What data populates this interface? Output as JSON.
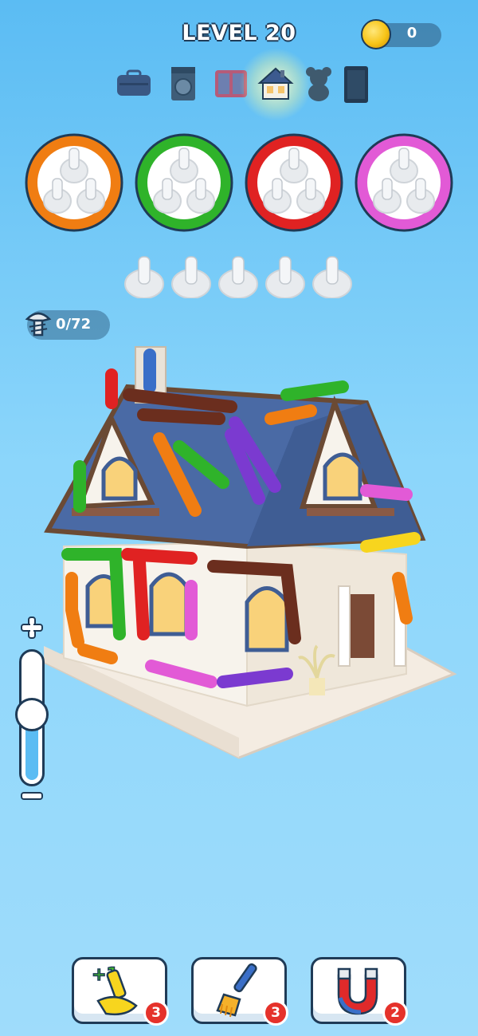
{
  "header": {
    "level_label": "LEVEL 20",
    "coins": "0"
  },
  "categories": [
    {
      "icon": "suitcase-icon",
      "selected": false
    },
    {
      "icon": "washing-machine-icon",
      "selected": false
    },
    {
      "icon": "wardrobe-icon",
      "selected": false
    },
    {
      "icon": "house-icon",
      "selected": true
    },
    {
      "icon": "teddy-bear-icon",
      "selected": false
    },
    {
      "icon": "cabinet-icon",
      "selected": false
    }
  ],
  "trays": [
    {
      "color": "#f07d12",
      "name": "orange"
    },
    {
      "color": "#2fb32a",
      "name": "green"
    },
    {
      "color": "#e02222",
      "name": "red"
    },
    {
      "color": "#e25ad6",
      "name": "pink"
    }
  ],
  "pegs_free": 5,
  "progress": {
    "text": "0/72",
    "icon": "screw-icon"
  },
  "zoom": {
    "level": 0.45,
    "plus_icon": "plus-icon",
    "minus_icon": "minus-icon"
  },
  "boosters": [
    {
      "name": "add-slot",
      "icon": "plus-one-peg-icon",
      "plus_text": "+1",
      "count": "3"
    },
    {
      "name": "brush",
      "icon": "brush-icon",
      "count": "3"
    },
    {
      "name": "magnet",
      "icon": "magnet-icon",
      "count": "2"
    }
  ],
  "colors": {
    "outline": "#1f3b57",
    "background": "#7ccdf8",
    "badge": "#e5322b"
  }
}
